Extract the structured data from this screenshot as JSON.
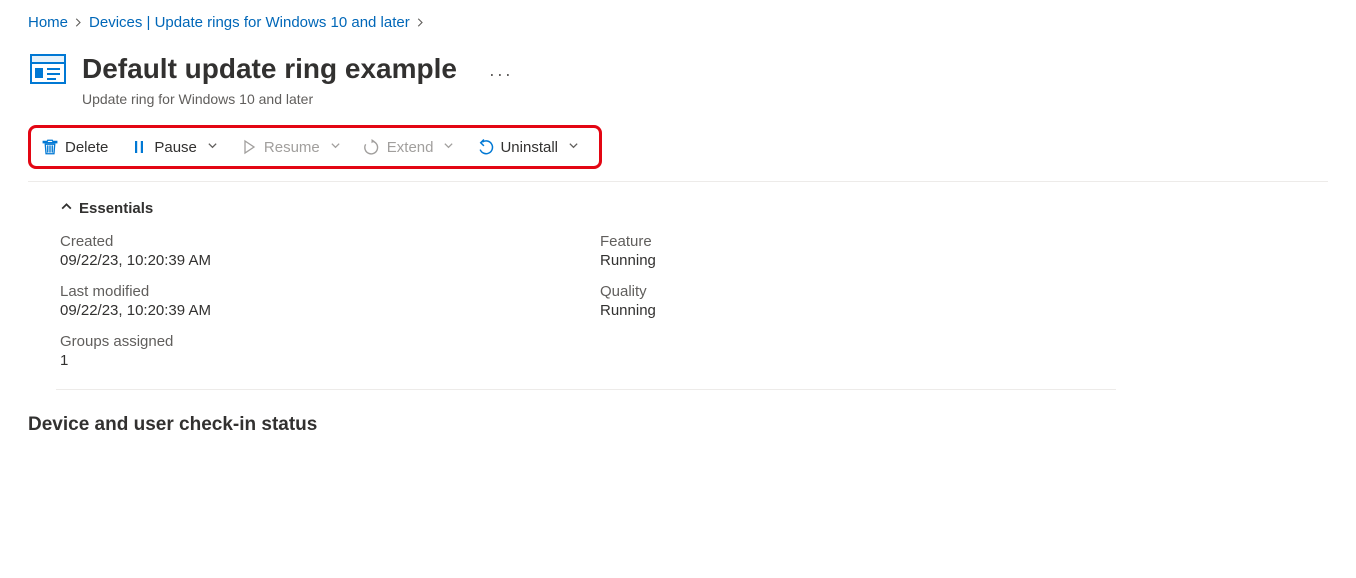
{
  "breadcrumb": {
    "home": "Home",
    "devices": "Devices | Update rings for Windows 10 and later"
  },
  "header": {
    "title": "Default update ring example",
    "subtitle": "Update ring for Windows 10 and later",
    "ellipsis": "···"
  },
  "toolbar": {
    "delete": "Delete",
    "pause": "Pause",
    "resume": "Resume",
    "extend": "Extend",
    "uninstall": "Uninstall"
  },
  "essentials": {
    "title": "Essentials",
    "left": {
      "created_label": "Created",
      "created_value": "09/22/23, 10:20:39 AM",
      "modified_label": "Last modified",
      "modified_value": "09/22/23, 10:20:39 AM",
      "groups_label": "Groups assigned",
      "groups_value": "1"
    },
    "right": {
      "feature_label": "Feature",
      "feature_value": "Running",
      "quality_label": "Quality",
      "quality_value": "Running"
    }
  },
  "section": {
    "checkin_title": "Device and user check-in status"
  }
}
